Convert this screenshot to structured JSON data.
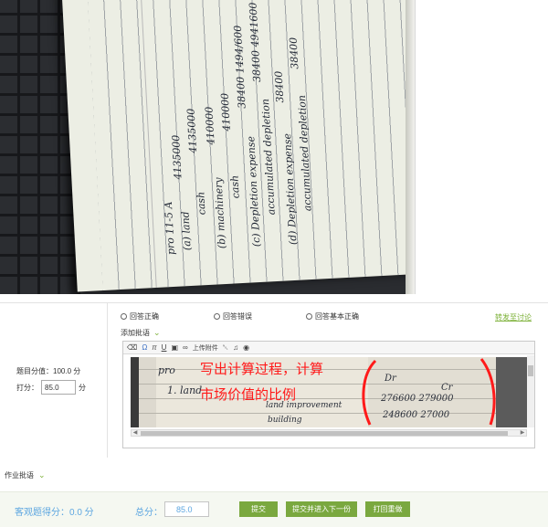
{
  "photo": {
    "handwriting": {
      "title": "pro 11-5 A",
      "line_a": "(a) land",
      "line_a_value": "4135000",
      "line_a_credit": "cash",
      "line_a_credit_value": "4135000",
      "line_b": "(b) machinery",
      "line_b_value": "410000",
      "line_b_credit": "cash",
      "line_b_credit_value": "410000",
      "line_c": "(c) Depletion expense",
      "line_c_value": "38400 1494/600",
      "line_c_credit": "accumulated depletion",
      "line_c_credit_value": "38400 4941600",
      "line_d": "(d) Depletion expense",
      "line_d_value": "38400",
      "line_d_credit": "accumulated depletion",
      "line_d_credit_value": "38400"
    }
  },
  "grading": {
    "full_score_text": "题目分值：100.0 分",
    "score_label": "打分：",
    "score_value": "85.0",
    "score_unit": "分",
    "verdicts": [
      "回答正确",
      "回答错误",
      "回答基本正确"
    ],
    "forward_link": "转发至讨论",
    "add_comment_label": "添加批语",
    "toolbar": {
      "upload_attachment": "上传附件"
    },
    "comment_image": {
      "hw_pro": "pro",
      "hw_line1": "1. land",
      "hw_line2": "land improvement",
      "hw_line3": "building",
      "hw_dr": "Dr",
      "hw_cr": "Cr",
      "hw_v1": "276600  279000",
      "hw_v2": "248600  27000",
      "red_line1": "写出计算过程，计算",
      "red_line2": "市场价值的比例"
    }
  },
  "homework_comment": {
    "label": "作业批语"
  },
  "footer": {
    "objective_score": "客观题得分：0.0 分",
    "total_label": "总分：",
    "total_value": "85.0",
    "submit": "提交",
    "submit_next": "提交并进入下一份",
    "return_redo": "打回重做"
  },
  "colors": {
    "accent_green": "#7aa83f",
    "link_green": "#7bb036",
    "score_blue": "#5da6e0",
    "annotation_red": "#ff1a1a"
  }
}
